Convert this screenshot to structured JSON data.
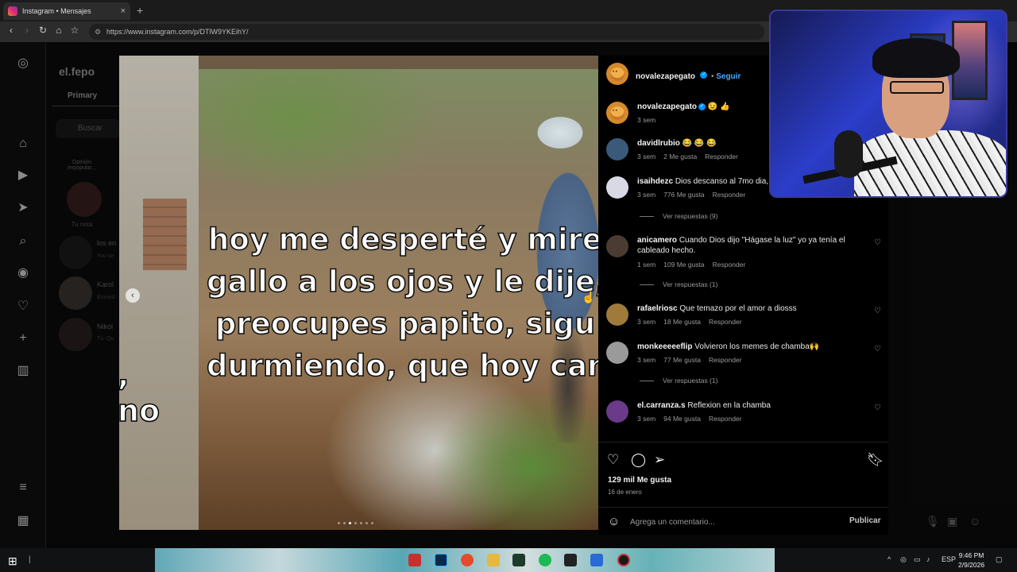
{
  "browser": {
    "tab_title": "Instagram • Mensajes",
    "tab_close": "×",
    "new_tab": "+",
    "url": "https://www.instagram.com/p/DTlW9YKEihY/",
    "nav": {
      "back": "‹",
      "forward": "›",
      "reload": "↻",
      "home": "⌂",
      "bookmark": "☆"
    }
  },
  "dm_panel": {
    "username": "el.fepo",
    "tab": "Primary",
    "search_placeholder": "Buscar",
    "note_label": "Opinión impopular...",
    "your_note": "Tu nota",
    "rows": [
      {
        "name": "los en",
        "sub": "You se"
      },
      {
        "name": "Karol",
        "sub": "Enviast"
      },
      {
        "name": "Nikol",
        "sub": "Tú: Qu"
      }
    ]
  },
  "post": {
    "caption_lines": [
      "hoy me desperté y mire",
      "gallo a los ojos y le dije, n",
      "preocupes papito, sigu",
      "durmiendo, que hoy cant"
    ],
    "left_fragments": [
      ",",
      "no"
    ],
    "prev_arrow": "‹",
    "carousel_total": 7,
    "carousel_active": 2
  },
  "panel": {
    "author": "novalezapegato",
    "follow": "Seguir",
    "comments": [
      {
        "user": "novalezapegato",
        "text": "😉 👍",
        "time": "3 sem",
        "likes": "",
        "reply": "",
        "verified": true,
        "heart": false,
        "avatar_color": "#d58a2c"
      },
      {
        "user": "davidlrubio",
        "text": "😂 😂 😂",
        "time": "3 sem",
        "likes": "2 Me gusta",
        "reply": "Responder",
        "verified": false,
        "heart": false,
        "avatar_color": "#3b5a7a"
      },
      {
        "user": "isaihdezc",
        "text": "Dios descanso al 7mo dia, p",
        "time": "3 sem",
        "likes": "776 Me gusta",
        "reply": "Responder",
        "verified": false,
        "heart": false,
        "avatar_color": "#d9d9e6",
        "replies": "Ver respuestas (9)"
      },
      {
        "user": "anicamero",
        "text": "Cuando Dios dijo \"Hágase la luz\" yo ya tenía el cableado hecho.",
        "time": "1 sem",
        "likes": "109 Me gusta",
        "reply": "Responder",
        "verified": false,
        "heart": true,
        "avatar_color": "#4a3b33",
        "replies": "Ver respuestas (1)"
      },
      {
        "user": "rafaelriosc",
        "text": "Que temazo por el amor a diosss",
        "time": "3 sem",
        "likes": "18 Me gusta",
        "reply": "Responder",
        "verified": false,
        "heart": true,
        "avatar_color": "#a07a3a"
      },
      {
        "user": "monkeeeeeflip",
        "text": "Volvieron los memes de chamba🙌",
        "time": "3 sem",
        "likes": "77 Me gusta",
        "reply": "Responder",
        "verified": false,
        "heart": true,
        "avatar_color": "#9a9a9a",
        "replies": "Ver respuestas (1)"
      },
      {
        "user": "el.carranza.s",
        "text": "Reflexion en la chamba",
        "time": "3 sem",
        "likes": "94 Me gusta",
        "reply": "Responder",
        "verified": false,
        "heart": true,
        "avatar_color": "#6b3a8a"
      }
    ],
    "likes_count": "129 mil Me gusta",
    "date": "16 de enero",
    "comment_placeholder": "Agrega un comentario...",
    "publish": "Publicar"
  },
  "taskbar": {
    "language": "ESP",
    "time": "9:46 PM",
    "date": "2/9/2026"
  },
  "icons": {
    "rail": [
      "instagram-icon",
      "home-icon",
      "reels-icon",
      "messages-icon",
      "search-icon",
      "explore-icon",
      "heart-icon",
      "create-icon",
      "dashboard-icon",
      "menu-icon",
      "apps-icon"
    ],
    "actions": [
      "like-icon",
      "comment-icon",
      "share-icon",
      "save-icon"
    ]
  },
  "colors": {
    "link_blue": "#4aa8ff",
    "verified_blue": "#0095f6",
    "panel_bg": "#000000"
  }
}
